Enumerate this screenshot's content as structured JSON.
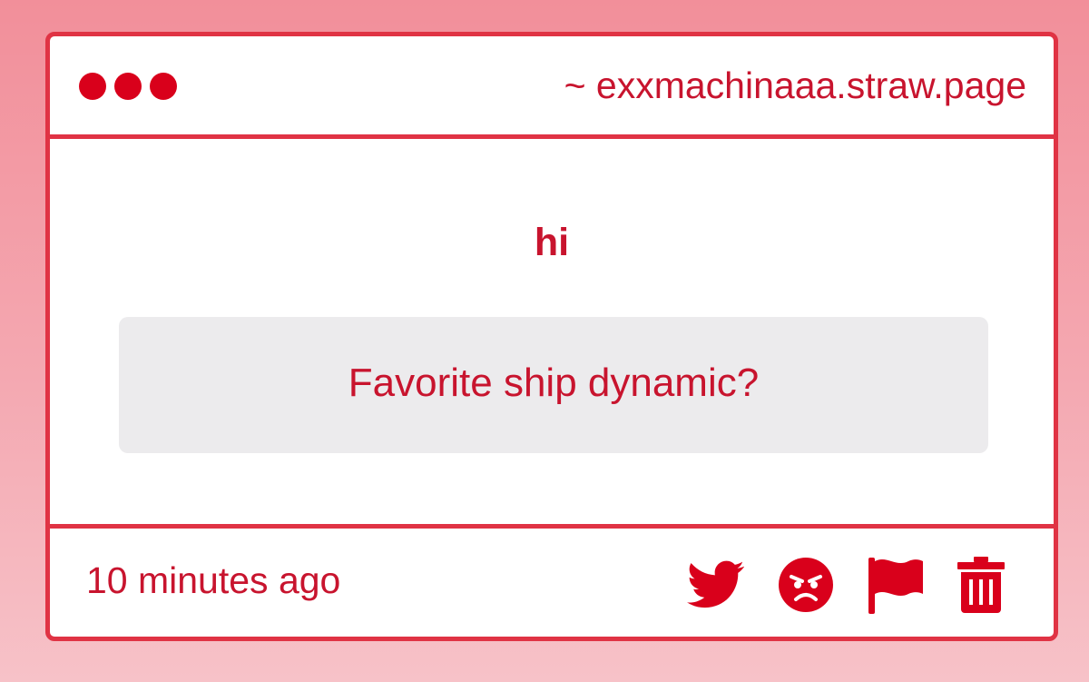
{
  "window": {
    "url": "~ exxmachinaaa.straw.page"
  },
  "post": {
    "title": "hi",
    "question": "Favorite ship dynamic?"
  },
  "footer": {
    "timestamp": "10 minutes ago",
    "actions": [
      {
        "icon": "twitter-icon"
      },
      {
        "icon": "angry-face-icon"
      },
      {
        "icon": "flag-icon"
      },
      {
        "icon": "trash-icon"
      }
    ]
  },
  "colors": {
    "accent": "#c8142e",
    "border": "#e03344",
    "dot": "#d9001b",
    "question_bg": "#ecebed"
  }
}
